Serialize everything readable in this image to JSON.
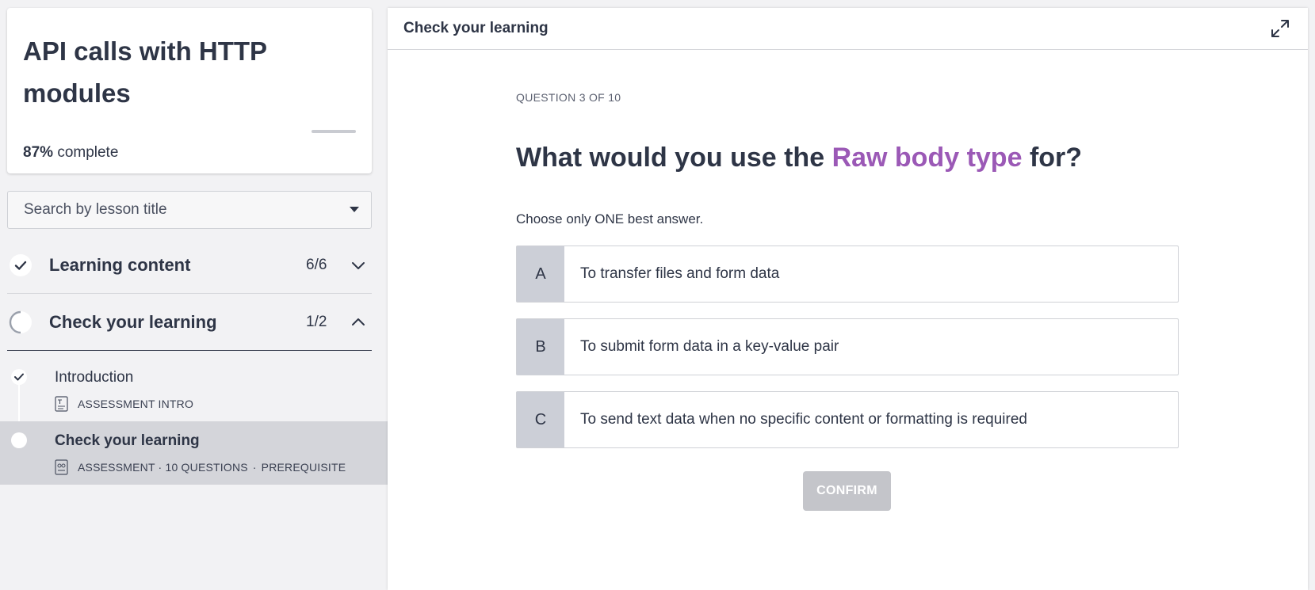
{
  "course": {
    "title": "API calls with HTTP modules",
    "progress_percent": "87%",
    "progress_suffix": "complete",
    "progress_value": 0.87
  },
  "search": {
    "placeholder": "Search by lesson title"
  },
  "sections": [
    {
      "label": "Learning content",
      "count": "6/6",
      "status": "complete",
      "expanded": false
    },
    {
      "label": "Check your learning",
      "count": "1/2",
      "status": "in-progress",
      "expanded": true
    }
  ],
  "lessons": [
    {
      "title": "Introduction",
      "meta": [
        "ASSESSMENT INTRO"
      ],
      "icon": "document-icon",
      "status": "complete"
    },
    {
      "title": "Check your learning",
      "meta": [
        "ASSESSMENT · 10 QUESTIONS",
        "PREREQUISITE"
      ],
      "icon": "assessment-icon",
      "status": "current"
    }
  ],
  "main": {
    "header_title": "Check your learning",
    "question_number": "QUESTION 3 OF 10",
    "question_prefix": "What would you use the ",
    "question_highlight": "Raw body type",
    "question_suffix": " for?",
    "instruction": "Choose only ONE best answer.",
    "options": [
      {
        "letter": "A",
        "text": "To transfer files and form data"
      },
      {
        "letter": "B",
        "text": "To submit form data in a key-value pair"
      },
      {
        "letter": "C",
        "text": "To send text data when no specific content or formatting is required"
      }
    ],
    "confirm_label": "CONFIRM"
  },
  "colors": {
    "highlight": "#9b59b6",
    "text": "#2e3546",
    "active_lesson_bg": "#d4d5da",
    "option_letter_bg": "#cccfd7",
    "confirm_disabled": "#c4c5ca"
  }
}
